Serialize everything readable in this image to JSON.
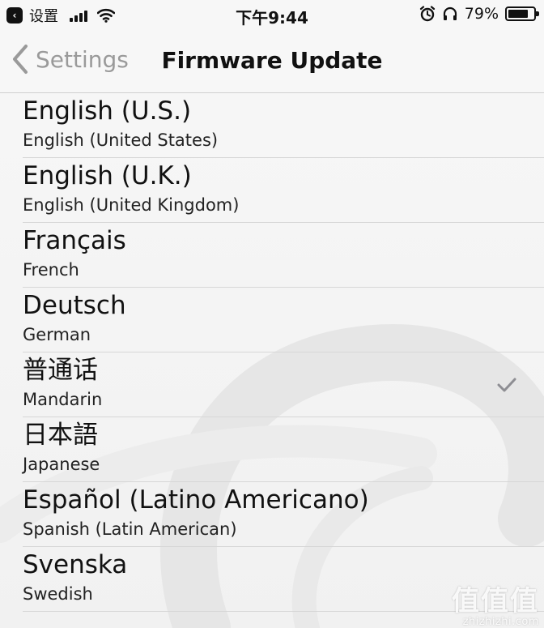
{
  "status_bar": {
    "back_app_label": "设置",
    "time": "下午9:44",
    "battery_percent": "79%",
    "battery_level": 0.79,
    "icons": [
      "back-app-icon",
      "signal-icon",
      "wifi-icon",
      "alarm-icon",
      "headphone-icon",
      "battery-icon"
    ]
  },
  "nav": {
    "back_label": "Settings",
    "title": "Firmware Update"
  },
  "languages": [
    {
      "primary": "English (U.S.)",
      "secondary": "English (United States)",
      "selected": false
    },
    {
      "primary": "English (U.K.)",
      "secondary": "English (United Kingdom)",
      "selected": false
    },
    {
      "primary": "Français",
      "secondary": "French",
      "selected": false
    },
    {
      "primary": "Deutsch",
      "secondary": "German",
      "selected": false
    },
    {
      "primary": "普通话",
      "secondary": "Mandarin",
      "selected": true
    },
    {
      "primary": "日本語",
      "secondary": "Japanese",
      "selected": false
    },
    {
      "primary": "Español (Latino Americano)",
      "secondary": "Spanish (Latin American)",
      "selected": false
    },
    {
      "primary": "Svenska",
      "secondary": "Swedish",
      "selected": false
    }
  ],
  "watermark": {
    "logo": "值值值",
    "url": "zhizhizhi.com"
  },
  "colors": {
    "background": "#f3f3f3",
    "separator": "#d7d7d7",
    "nav_back": "#9a9a9a",
    "checkmark": "#8e8e93"
  }
}
